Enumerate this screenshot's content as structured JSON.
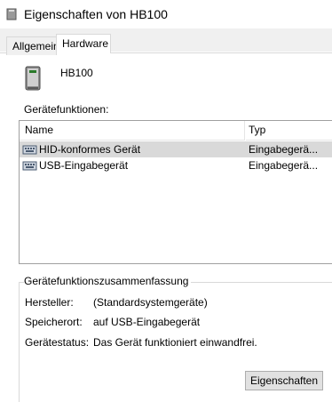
{
  "window": {
    "title": "Eigenschaften von HB100"
  },
  "tabs": [
    {
      "label": "Allgemein"
    },
    {
      "label": "Hardware"
    }
  ],
  "device": {
    "name": "HB100",
    "icon": "hid-device-icon"
  },
  "functions": {
    "group_label": "Gerätefunktionen:",
    "columns": {
      "name": "Name",
      "type": "Typ"
    },
    "rows": [
      {
        "name": "HID-konformes Gerät",
        "type": "Eingabegerä...",
        "selected": true
      },
      {
        "name": "USB-Eingabegerät",
        "type": "Eingabegerä...",
        "selected": false
      }
    ]
  },
  "summary": {
    "title": "Gerätefunktionszusammenfassung",
    "manufacturer_label": "Hersteller:",
    "manufacturer_value": "(Standardsystemgeräte)",
    "location_label": "Speicherort:",
    "location_value": "auf USB-Eingabegerät",
    "status_label": "Gerätestatus:",
    "status_value": "Das Gerät funktioniert einwandfrei."
  },
  "buttons": {
    "properties": "Eigenschaften"
  },
  "colors": {
    "selection": "#d9d9d9",
    "tab_bg": "#f0f0f0",
    "button_bg": "#e1e1e1"
  }
}
